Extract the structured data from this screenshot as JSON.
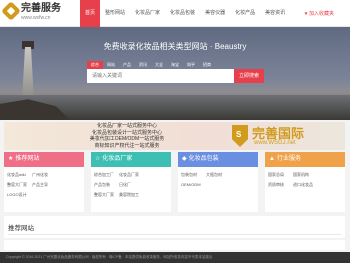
{
  "logo": {
    "title": "完善服务",
    "subtitle": "www.wsfw.cn"
  },
  "nav": {
    "items": [
      "首页",
      "整形网站",
      "化妆品厂家",
      "化妆品包装",
      "美容仪器",
      "化妆产品",
      "美容资讯"
    ]
  },
  "fav_label": "加入收藏夹",
  "hero": {
    "title": "免费收录化妆品相关类型网站 · Beaustry",
    "search_tabs": [
      "综合",
      "网站",
      "产品",
      "资讯",
      "大全",
      "淘宝",
      "知乎",
      "招商"
    ],
    "search_placeholder": "请输入关键词",
    "search_button": "立即搜索"
  },
  "banner": {
    "line1": "化妆品厂家一站式服务中心",
    "line2": "化妆品包装设计一站式服务中心",
    "line3": "美妆代加工OEM/ODM一站式服务",
    "line4": "商标知识产权代注一站式服务",
    "brand": "完善国际",
    "brand_url": "www.WSGJ.net",
    "shield_letter": "S"
  },
  "cards": [
    {
      "title": "推荐网站",
      "icon": "★",
      "color": "#ef6f86",
      "links": [
        "化妆品wiki",
        "广州化妆",
        "整容大厂家",
        "产品主导",
        "LOGO设计"
      ]
    },
    {
      "title": "化妆品厂家",
      "icon": "☆",
      "color": "#3dbfb3",
      "links": [
        "综合加工厂",
        "化妆品厂家",
        "产品包装",
        "日化厂",
        "整容大厂家",
        "美容院加工"
      ]
    },
    {
      "title": "化妆品包装",
      "icon": "◆",
      "color": "#6a8fe0",
      "links": [
        "包装包材",
        "大瓶包材",
        "OEM/ODM"
      ]
    },
    {
      "title": "行业服务",
      "icon": "▲",
      "color": "#f0a24a",
      "links": [
        "国家总局",
        "国家机构",
        "资质审核",
        "进口化妆品"
      ]
    }
  ],
  "section": {
    "title": "推荐网站"
  },
  "footer": {
    "text": "Copyright © 2016-2021 广州完善化妆品服务有限公司 · 版权所有 · 粤ICP备 · 本站提供免费收录服务，网站所收录内容不代表本站观点"
  }
}
